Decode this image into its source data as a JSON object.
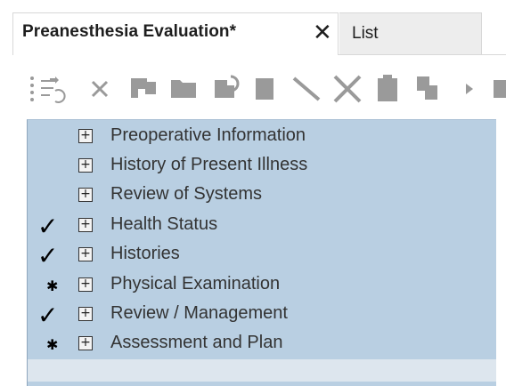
{
  "tabs": {
    "active": {
      "label": "Preanesthesia Evaluation*",
      "close_icon": "close-icon"
    },
    "inactive": {
      "label": "List"
    }
  },
  "toolbar": {
    "icons": [
      "list-insert-icon",
      "delete-x-icon",
      "flag-icon",
      "folder-icon",
      "refresh-icon",
      "document-icon",
      "line-icon",
      "cut-icon",
      "clipboard-icon",
      "copy-icon",
      "play-icon",
      "square-icon"
    ]
  },
  "sections": [
    {
      "label": "Preoperative Information",
      "status": "none"
    },
    {
      "label": "History of Present Illness",
      "status": "none"
    },
    {
      "label": "Review of Systems",
      "status": "none"
    },
    {
      "label": "Health Status",
      "status": "complete"
    },
    {
      "label": "Histories",
      "status": "complete"
    },
    {
      "label": "Physical Examination",
      "status": "required"
    },
    {
      "label": "Review / Management",
      "status": "complete"
    },
    {
      "label": "Assessment and Plan",
      "status": "required"
    }
  ],
  "glyphs": {
    "expander": "+",
    "check": "✓",
    "required": "✱"
  },
  "colors": {
    "panel": "#b9cfe2",
    "required": "#e0393e",
    "icons": "#9a9a9a"
  }
}
